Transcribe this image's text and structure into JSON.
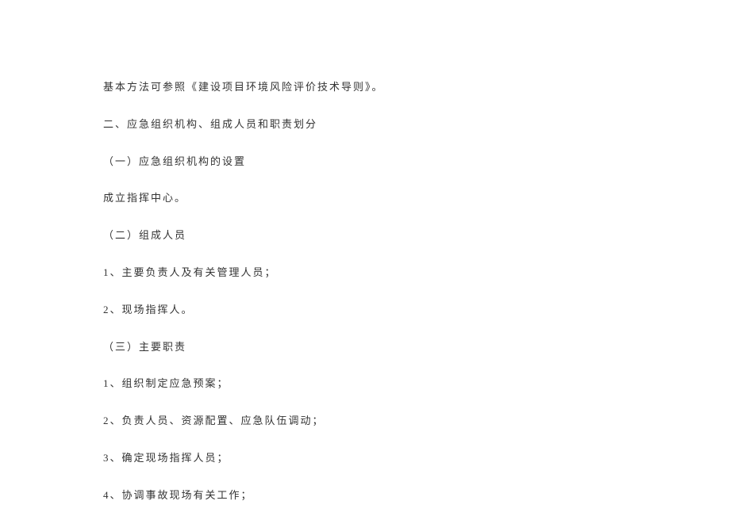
{
  "lines": [
    "基本方法可参照《建设项目环境风险评价技术导则》。",
    "二、应急组织机构、组成人员和职责划分",
    "（一）应急组织机构的设置",
    "成立指挥中心。",
    "（二）组成人员",
    "1、主要负责人及有关管理人员；",
    "2、现场指挥人。",
    "（三）主要职责",
    "1、组织制定应急预案；",
    "2、负责人员、资源配置、应急队伍调动；",
    "3、确定现场指挥人员；",
    "4、协调事故现场有关工作；"
  ]
}
